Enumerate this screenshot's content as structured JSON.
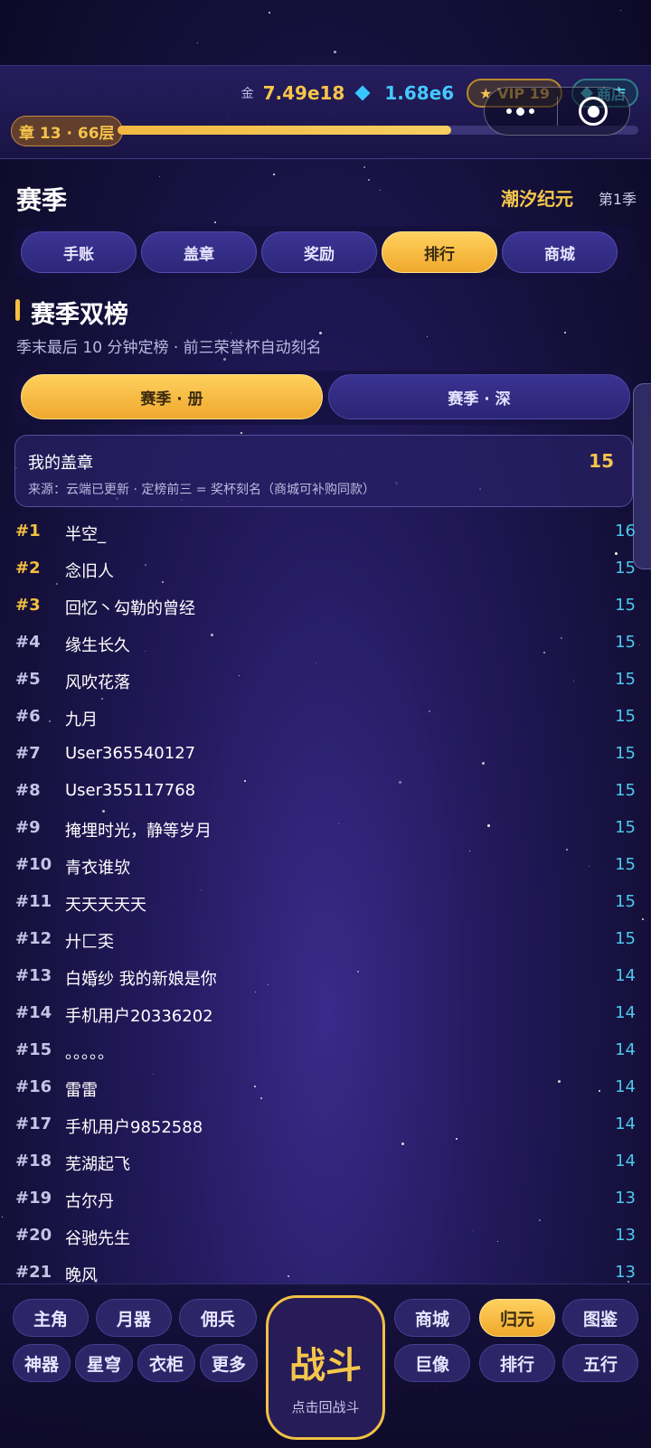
{
  "header": {
    "gold_label": "金",
    "gold_value": "7.49e18",
    "gem_value": "1.68e6",
    "vip_label": "★ VIP 19",
    "shop_label": "商店",
    "chapter_badge": "章 13 · 66层",
    "progress_fraction": 0.64
  },
  "season": {
    "title": "赛季",
    "name": "潮汐纪元",
    "number": "第1季",
    "tabs": [
      "手账",
      "盖章",
      "奖励",
      "排行",
      "商城"
    ],
    "active_tab": 3
  },
  "board": {
    "title": "赛季双榜",
    "subtitle": "季末最后 10 分钟定榜 · 前三荣誉杯自动刻名",
    "sub_tabs": [
      "赛季 · 册",
      "赛季 · 深"
    ],
    "active_sub_tab": 0,
    "my_label": "我的盖章",
    "my_value": "15",
    "source_note": "来源：云端已更新 · 定榜前三 = 奖杯刻名（商城可补购同款）"
  },
  "rankings": [
    {
      "rank": "#1",
      "name": "半空_",
      "score": "16"
    },
    {
      "rank": "#2",
      "name": "念旧人",
      "score": "15"
    },
    {
      "rank": "#3",
      "name": "回忆丶勾勒的曾经",
      "score": "15"
    },
    {
      "rank": "#4",
      "name": "缘生长久",
      "score": "15"
    },
    {
      "rank": "#5",
      "name": "风吹花落",
      "score": "15"
    },
    {
      "rank": "#6",
      "name": "九月",
      "score": "15"
    },
    {
      "rank": "#7",
      "name": "User365540127",
      "score": "15"
    },
    {
      "rank": "#8",
      "name": "User355117768",
      "score": "15"
    },
    {
      "rank": "#9",
      "name": "掩埋时光，静等岁月",
      "score": "15"
    },
    {
      "rank": "#10",
      "name": "青衣谁欤",
      "score": "15"
    },
    {
      "rank": "#11",
      "name": "天天天天天",
      "score": "15"
    },
    {
      "rank": "#12",
      "name": "廾匚奀",
      "score": "15"
    },
    {
      "rank": "#13",
      "name": "白婚纱  我的新娘是你",
      "score": "14"
    },
    {
      "rank": "#14",
      "name": "手机用户20336202",
      "score": "14"
    },
    {
      "rank": "#15",
      "name": "。。。。。",
      "score": "14"
    },
    {
      "rank": "#16",
      "name": "雷雷",
      "score": "14"
    },
    {
      "rank": "#17",
      "name": "手机用户9852588",
      "score": "14"
    },
    {
      "rank": "#18",
      "name": "芜湖起飞",
      "score": "14"
    },
    {
      "rank": "#19",
      "name": "古尔丹",
      "score": "13"
    },
    {
      "rank": "#20",
      "name": "谷驰先生",
      "score": "13"
    },
    {
      "rank": "#21",
      "name": "晚风",
      "score": "13"
    }
  ],
  "bottom_nav": {
    "left_row1": [
      "主角",
      "月器",
      "佣兵"
    ],
    "left_row2": [
      "神器",
      "星穹",
      "衣柜",
      "更多"
    ],
    "fight_label": "战斗",
    "fight_sub": "点击回战斗",
    "right_row1": [
      "商城",
      "归元",
      "图鉴"
    ],
    "right_row2": [
      "巨像",
      "排行",
      "五行"
    ],
    "active_right_row1": 1
  },
  "colors": {
    "accent_gold": "#f5c03f",
    "score_cyan": "#4cc9ee",
    "background": "#241a5e"
  }
}
